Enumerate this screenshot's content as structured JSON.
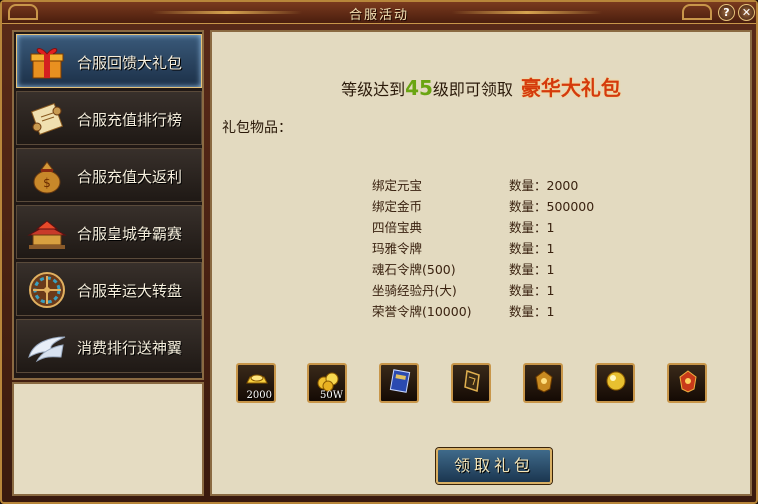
{
  "window": {
    "title": "合服活动",
    "help_label": "?",
    "close_label": "✕"
  },
  "sidebar": {
    "items": [
      {
        "label": "合服回馈大礼包",
        "icon": "gift-box-icon",
        "active": true
      },
      {
        "label": "合服充值排行榜",
        "icon": "scroll-icon",
        "active": false
      },
      {
        "label": "合服充值大返利",
        "icon": "money-bag-icon",
        "active": false
      },
      {
        "label": "合服皇城争霸赛",
        "icon": "palace-icon",
        "active": false
      },
      {
        "label": "合服幸运大转盘",
        "icon": "wheel-icon",
        "active": false
      },
      {
        "label": "消费排行送神翼",
        "icon": "wings-icon",
        "active": false
      }
    ]
  },
  "main": {
    "headline_prefix": "等级达到",
    "headline_level": "45",
    "headline_suffix": "级即可领取",
    "headline_gift": "豪华大礼包",
    "section_label": "礼包物品：",
    "items": [
      {
        "name": "绑定元宝",
        "qty": "数量：2000"
      },
      {
        "name": "绑定金币",
        "qty": "数量：500000"
      },
      {
        "name": "四倍宝典",
        "qty": "数量：1"
      },
      {
        "name": "玛雅令牌",
        "qty": "数量：1"
      },
      {
        "name": "魂石令牌(500)",
        "qty": "数量：1"
      },
      {
        "name": "坐骑经验丹(大)",
        "qty": "数量：1"
      },
      {
        "name": "荣誉令牌(10000)",
        "qty": "数量：1"
      }
    ],
    "icon_slots": [
      {
        "icon": "gold-ingot-icon",
        "count": "2000"
      },
      {
        "icon": "gold-coins-icon",
        "count": "50W"
      },
      {
        "icon": "book-icon",
        "count": ""
      },
      {
        "icon": "maya-token-icon",
        "count": ""
      },
      {
        "icon": "soul-stone-token-icon",
        "count": ""
      },
      {
        "icon": "pearl-icon",
        "count": ""
      },
      {
        "icon": "honor-token-icon",
        "count": ""
      }
    ],
    "claim_label": "领取礼包"
  },
  "colors": {
    "level": "#6aa512",
    "gift": "#d43a0c",
    "frame_gold": "#c8964a",
    "parchment": "#e3dac0"
  }
}
